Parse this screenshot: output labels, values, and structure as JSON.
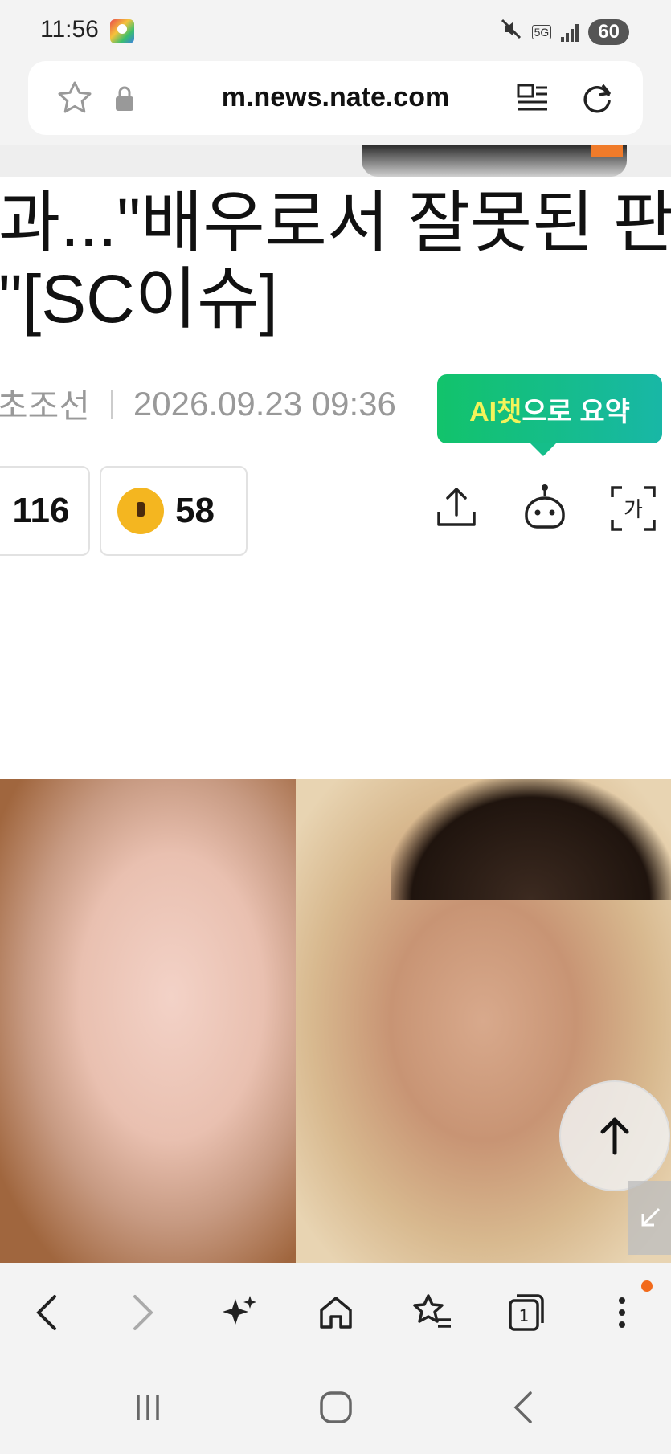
{
  "status_bar": {
    "time": "11:56",
    "network": "5G",
    "battery": "60"
  },
  "browser": {
    "url": "m.news.nate.com"
  },
  "article": {
    "headline_line0": "··′ ···· ··· ·····",
    "headline_line1": "과...\"배우로서 잘못된 판",
    "headline_line2": "\"[SC이슈]",
    "source": "스포츠조선",
    "source_visible": "초조선",
    "datetime": "2026.09.23 09:36",
    "ai_summary": {
      "part_highlight": "AI챗",
      "part_rest": "으로 요약"
    },
    "reactions": {
      "first_count": "116",
      "second_count": "58"
    },
    "actions": {
      "share": "share-icon",
      "ai_bot": "robot-icon",
      "font": "가"
    }
  },
  "colors": {
    "ai_gradient_start": "#12c36b",
    "ai_gradient_end": "#18b7a6",
    "notification_dot": "#f26a1b"
  }
}
